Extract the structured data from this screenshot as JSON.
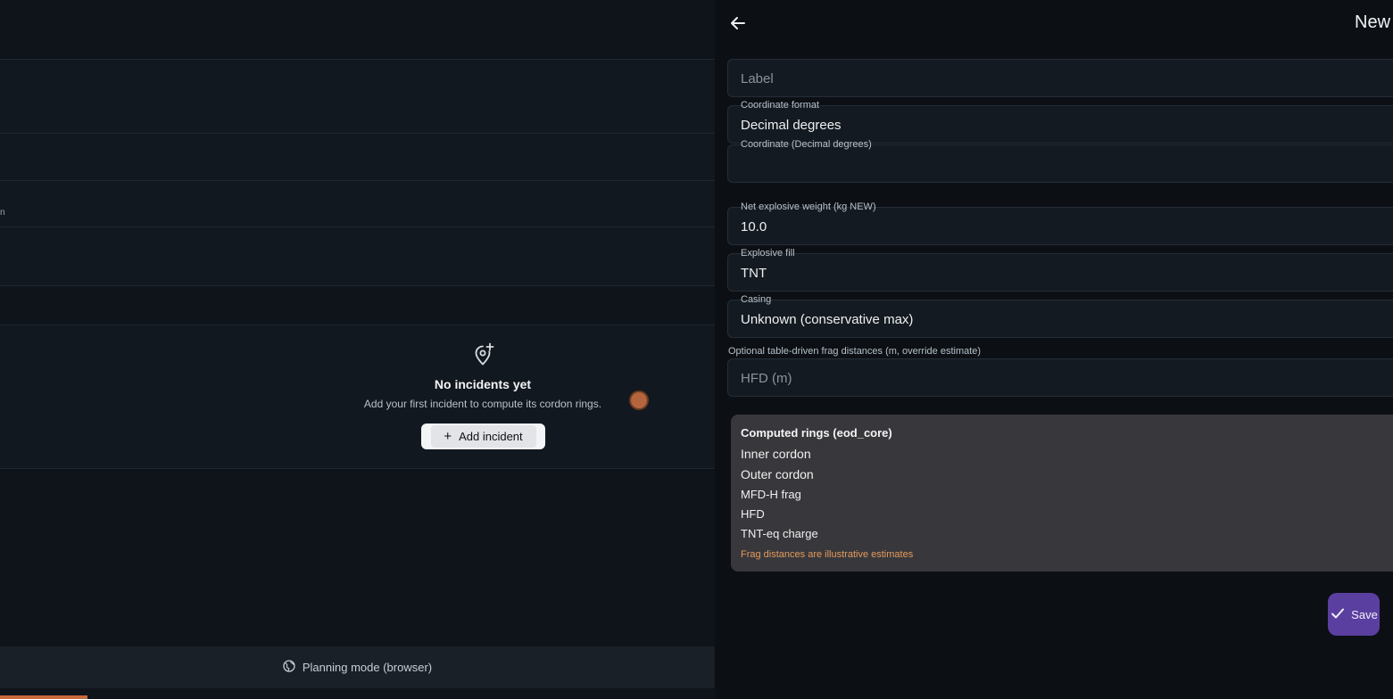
{
  "incidents": {
    "truncated_text": "n",
    "empty_state": {
      "icon": "add-location-icon",
      "title": "No incidents yet",
      "subtitle": "Add your first incident to compute its cordon rings.",
      "add_button_label": "Add incident"
    },
    "footer": {
      "icon": "globe-icon",
      "label": "Planning mode (browser)"
    }
  },
  "editor": {
    "title": "New",
    "back_icon": "arrow-left-icon",
    "fields": {
      "label": {
        "placeholder": "Label",
        "value": ""
      },
      "coordinate_format": {
        "label": "Coordinate format",
        "value": "Decimal degrees"
      },
      "coordinate": {
        "label": "Coordinate (Decimal degrees)",
        "value": ""
      },
      "net_explosive_weight": {
        "label": "Net explosive weight (kg NEW)",
        "value": "10.0"
      },
      "explosive_fill": {
        "label": "Explosive fill",
        "value": "TNT"
      },
      "casing": {
        "label": "Casing",
        "value": "Unknown (conservative max)"
      },
      "frag_hint": "Optional table-driven frag distances (m, override estimate)",
      "hfd": {
        "placeholder": "HFD (m)",
        "value": ""
      }
    },
    "computed": {
      "title": "Computed rings (eod_core)",
      "items": [
        "Inner cordon",
        "Outer cordon",
        "MFD-H frag",
        "HFD",
        "TNT-eq charge"
      ],
      "warning": "Frag distances are illustrative estimates"
    },
    "save_label": "Save"
  },
  "colors": {
    "accent": "#5b3fa0",
    "warning": "#e59a5c",
    "progress": "#c96a3d"
  }
}
